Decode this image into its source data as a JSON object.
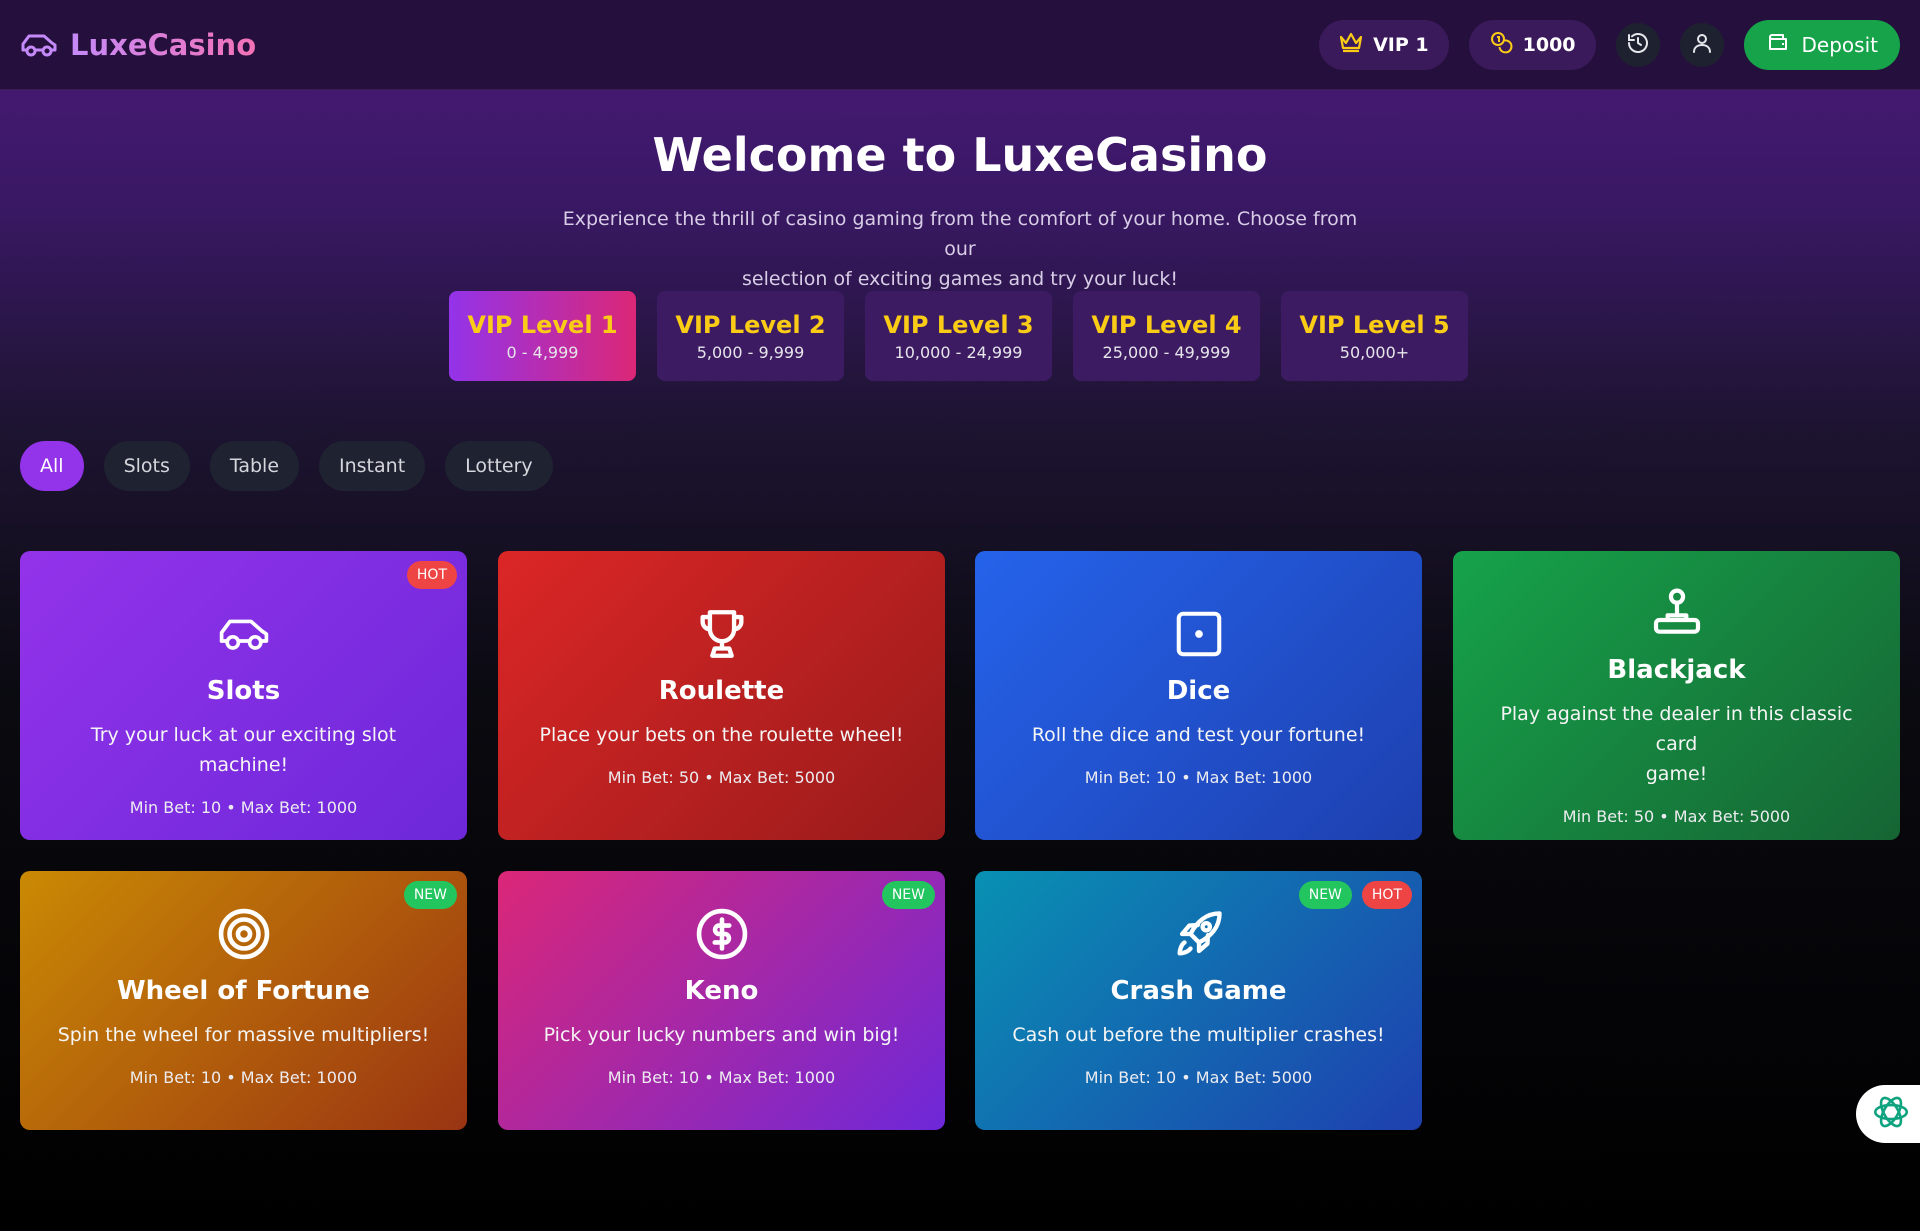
{
  "header": {
    "brand": "LuxeCasino",
    "vip_label": "VIP 1",
    "balance": "1000",
    "deposit_label": "Deposit"
  },
  "hero": {
    "title": "Welcome to LuxeCasino",
    "subtitle_line1": "Experience the thrill of casino gaming from the comfort of your home. Choose from our",
    "subtitle_line2": "selection of exciting games and try your luck!"
  },
  "vip_levels": [
    {
      "name": "VIP Level 1",
      "range": "0 - 4,999",
      "active": true
    },
    {
      "name": "VIP Level 2",
      "range": "5,000 - 9,999",
      "active": false
    },
    {
      "name": "VIP Level 3",
      "range": "10,000 - 24,999",
      "active": false
    },
    {
      "name": "VIP Level 4",
      "range": "25,000 - 49,999",
      "active": false
    },
    {
      "name": "VIP Level 5",
      "range": "50,000+",
      "active": false
    }
  ],
  "filters": [
    {
      "label": "All",
      "active": true
    },
    {
      "label": "Slots",
      "active": false
    },
    {
      "label": "Table",
      "active": false
    },
    {
      "label": "Instant",
      "active": false
    },
    {
      "label": "Lottery",
      "active": false
    }
  ],
  "games": [
    {
      "title": "Slots",
      "description": "Try your luck at our exciting slot machine!",
      "meta": "Min Bet: 10 • Max Bet: 1000",
      "badges": [
        "HOT"
      ],
      "icon": "car-icon"
    },
    {
      "title": "Roulette",
      "description": "Place your bets on the roulette wheel!",
      "meta": "Min Bet: 50 • Max Bet: 5000",
      "badges": [],
      "icon": "trophy-icon"
    },
    {
      "title": "Dice",
      "description": "Roll the dice and test your fortune!",
      "meta": "Min Bet: 10 • Max Bet: 1000",
      "badges": [],
      "icon": "dice-icon"
    },
    {
      "title": "Blackjack",
      "description_line1": "Play against the dealer in this classic card",
      "description_line2": "game!",
      "meta": "Min Bet: 50 • Max Bet: 5000",
      "badges": [],
      "icon": "joystick-icon"
    },
    {
      "title": "Wheel of Fortune",
      "description": "Spin the wheel for massive multipliers!",
      "meta": "Min Bet: 10 • Max Bet: 1000",
      "badges": [
        "NEW"
      ],
      "icon": "target-icon"
    },
    {
      "title": "Keno",
      "description": "Pick your lucky numbers and win big!",
      "meta": "Min Bet: 10 • Max Bet: 1000",
      "badges": [
        "NEW"
      ],
      "icon": "dollar-circle-icon"
    },
    {
      "title": "Crash Game",
      "description": "Cash out before the multiplier crashes!",
      "meta": "Min Bet: 10 • Max Bet: 5000",
      "badges": [
        "NEW",
        "HOT"
      ],
      "icon": "rocket-icon"
    }
  ],
  "colors": {
    "accent": "#9333ea",
    "deposit": "#16a34a",
    "vip_gold": "#facc15"
  }
}
